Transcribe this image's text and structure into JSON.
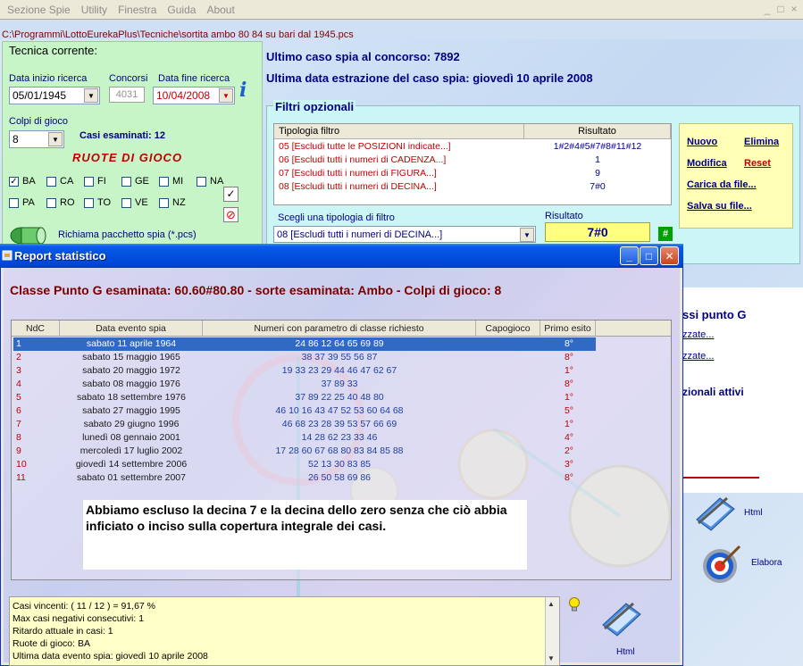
{
  "menu": [
    "Sezione Spie",
    "Utility",
    "Finestra",
    "Guida",
    "About"
  ],
  "path": "C:\\Programmi\\LottoEurekaPlus\\Tecniche\\sortita ambo 80 84 su bari dal 1945.pcs",
  "tecnica": {
    "title": "Tecnica corrente:",
    "data_inizio_label": "Data inizio ricerca",
    "data_inizio": "05/01/1945",
    "concorsi_label": "Concorsi",
    "concorsi": "4031",
    "data_fine_label": "Data fine ricerca",
    "data_fine": "10/04/2008",
    "colpi_label": "Colpi di gioco",
    "colpi": "8",
    "casi_esaminati": "Casi esaminati: 12",
    "ruote_title": "RUOTE DI GIOCO",
    "ruote": [
      {
        "name": "BA",
        "checked": true
      },
      {
        "name": "CA",
        "checked": false
      },
      {
        "name": "FI",
        "checked": false
      },
      {
        "name": "GE",
        "checked": false
      },
      {
        "name": "MI",
        "checked": false
      },
      {
        "name": "NA",
        "checked": false
      },
      {
        "name": "PA",
        "checked": false
      },
      {
        "name": "RO",
        "checked": false
      },
      {
        "name": "TO",
        "checked": false
      },
      {
        "name": "VE",
        "checked": false
      },
      {
        "name": "NZ",
        "checked": false
      }
    ],
    "richiama": "Richiama pacchetto spia (*.pcs)"
  },
  "info": {
    "ultimo_caso": "Ultimo caso spia al concorso:  7892",
    "ultima_data": "Ultima data estrazione del caso spia:  giovedì 10 aprile 2008"
  },
  "filtri": {
    "title": "Filtri opzionali",
    "col_tipologia": "Tipologia filtro",
    "col_risultato": "Risultato",
    "rows": [
      {
        "tipo": "05 [Escludi tutte le POSIZIONI indicate...]",
        "ris": "1#2#4#5#7#8#11#12"
      },
      {
        "tipo": "06 [Escludi tutti i numeri di CADENZA...]",
        "ris": "1"
      },
      {
        "tipo": "07 [Escludi tutti i numeri di FIGURA...]",
        "ris": "9"
      },
      {
        "tipo": "08 [Escludi tutti i numeri di DECINA...]",
        "ris": "7#0"
      }
    ],
    "actions": {
      "nuovo": "Nuovo",
      "elimina": "Elimina",
      "modifica": "Modifica",
      "reset": "Reset",
      "carica": "Carica da file...",
      "salva": "Salva su file..."
    },
    "scegli_label": "Scegli una tipologia di filtro",
    "scegli_value": "08 [Escludi tutti i numeri di DECINA...]",
    "risultato_label": "Risultato",
    "risultato_value": "7#0",
    "hash": "#"
  },
  "right_panel": {
    "line1": "ssi punto G",
    "link1": "zzate...",
    "link2": "zzate...",
    "line2": "zionali attivi"
  },
  "report": {
    "window_title": "Report statistico",
    "classe": "Classe Punto G esaminata: 60.60#80.80 - sorte esaminata: Ambo - Colpi di gioco: 8",
    "columns": [
      "NdC",
      "Data evento spia",
      "Numeri con parametro di classe richiesto",
      "Capogioco",
      "Primo esito"
    ],
    "rows": [
      {
        "ndc": "1",
        "data": "sabato 11 aprile 1964",
        "numeri": "24 86 12 64 65 69 89",
        "esito": "8°"
      },
      {
        "ndc": "2",
        "data": "sabato 15 maggio 1965",
        "numeri": "38 37 39 55 56 87",
        "esito": "8°"
      },
      {
        "ndc": "3",
        "data": "sabato 20 maggio 1972",
        "numeri": "19 33 23 29 44 46 47 62 67",
        "esito": "1°"
      },
      {
        "ndc": "4",
        "data": "sabato 08 maggio 1976",
        "numeri": "37 89 33",
        "esito": "8°"
      },
      {
        "ndc": "5",
        "data": "sabato 18 settembre 1976",
        "numeri": "37 89 22 25 40 48 80",
        "esito": "1°"
      },
      {
        "ndc": "6",
        "data": "sabato 27 maggio 1995",
        "numeri": "46 10 16 43 47 52 53 60 64 68",
        "esito": "5°"
      },
      {
        "ndc": "7",
        "data": "sabato 29 giugno 1996",
        "numeri": "46 68 23 28 39 53 57 66 69",
        "esito": "1°"
      },
      {
        "ndc": "8",
        "data": "lunedì 08 gennaio 2001",
        "numeri": "14 28 62 23 33 46",
        "esito": "4°"
      },
      {
        "ndc": "9",
        "data": "mercoledì 17 luglio 2002",
        "numeri": "17 28 60 67 68 80 83 84 85 88",
        "esito": "2°"
      },
      {
        "ndc": "10",
        "data": "giovedì 14 settembre 2006",
        "numeri": "52 13 30 83 85",
        "esito": "3°"
      },
      {
        "ndc": "11",
        "data": "sabato 01 settembre 2007",
        "numeri": "26 50 58 69 86",
        "esito": "8°"
      }
    ],
    "note": "Abbiamo escluso la decina 7 e la decina dello zero senza che ciò abbia inficiato o inciso sulla copertura integrale dei casi.",
    "stats": [
      "Casi vincenti: ( 11 / 12 ) = 91,67 %",
      "Max casi negativi consecutivi: 1",
      "Ritardo attuale in casi: 1",
      "Ruote di gioco: BA",
      "Ultima data evento spia: giovedì 10 aprile 2008"
    ],
    "html_label": "Html"
  },
  "side_buttons": {
    "html": "Html",
    "elabora": "Elabora"
  },
  "colors": {
    "xp_blue": "#0250de",
    "accent_red": "#c00000",
    "navy": "#000080"
  }
}
